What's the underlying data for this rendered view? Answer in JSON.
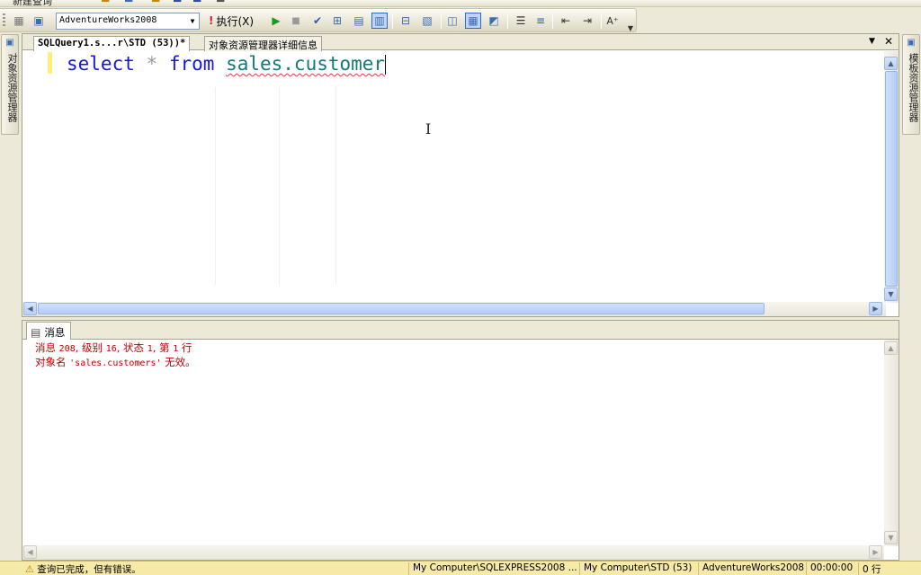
{
  "toolbar": {
    "top_cut_label": "新建查询",
    "database": "AdventureWorks2008",
    "execute_label": "执行(X)"
  },
  "left_rail": {
    "label": "对象资源管理器"
  },
  "right_rail": {
    "label": "模板资源管理器"
  },
  "tabs": [
    {
      "label": "SQLQuery1.s...r\\STD (53))*",
      "active": true
    },
    {
      "label": "对象资源管理器详细信息",
      "active": false
    }
  ],
  "editor": {
    "keyword_select": "select",
    "star": "*",
    "keyword_from": "from",
    "object_name": "sales.customer"
  },
  "results": {
    "tab_label": "消息",
    "line1": {
      "a": "消息 ",
      "n1": "208",
      "b": ", 级别 ",
      "n2": "16",
      "c": ", 状态 ",
      "n3": "1",
      "d": ", 第 ",
      "n4": "1",
      "e": " 行"
    },
    "line2": {
      "a": "对象名 ",
      "name": "'sales.customers'",
      "b": " 无效。"
    }
  },
  "status": {
    "message": "查询已完成，但有错误。",
    "server": "My Computer\\SQLEXPRESS2008 ...",
    "user": "My Computer\\STD (53)",
    "database": "AdventureWorks2008",
    "time": "00:00:00",
    "rows": "0 行"
  },
  "colors": {
    "keyword": "#1515e6",
    "object": "#127a7a",
    "error_text": "#c00000",
    "status_bg": "#f7e9a7"
  }
}
